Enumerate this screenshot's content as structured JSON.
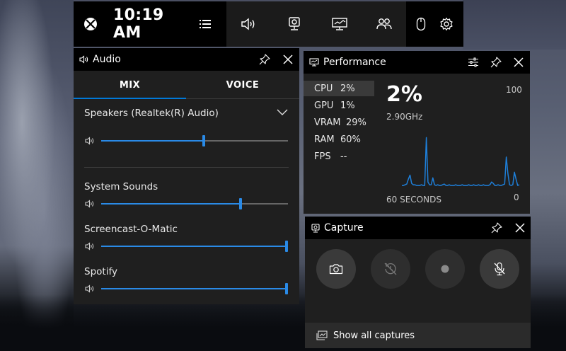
{
  "topbar": {
    "time": "10:19 AM"
  },
  "audio": {
    "title": "Audio",
    "tabs": [
      {
        "label": "MIX",
        "active": true
      },
      {
        "label": "VOICE",
        "active": false
      }
    ],
    "device": {
      "name": "Speakers (Realtek(R) Audio)",
      "volume": 0.55
    },
    "apps": [
      {
        "name": "System Sounds",
        "volume": 0.75
      },
      {
        "name": "Screencast-O-Matic",
        "volume": 1.0
      },
      {
        "name": "Spotify",
        "volume": 1.0
      }
    ]
  },
  "performance": {
    "title": "Performance",
    "metrics": [
      {
        "name": "CPU",
        "value": "2%",
        "selected": true
      },
      {
        "name": "GPU",
        "value": "1%",
        "selected": false
      },
      {
        "name": "VRAM",
        "value": "29%",
        "selected": false
      },
      {
        "name": "RAM",
        "value": "60%",
        "selected": false
      },
      {
        "name": "FPS",
        "value": "--",
        "selected": false
      }
    ],
    "current": "2%",
    "frequency": "2.90GHz",
    "max_label": "100",
    "min_label": "0",
    "time_label": "60 SECONDS",
    "chart_data": {
      "type": "line",
      "ylim": [
        0,
        100
      ],
      "color": "#1e7fd9",
      "values": [
        3,
        3,
        4,
        5,
        12,
        18,
        6,
        4,
        4,
        3,
        3,
        3,
        4,
        3,
        3,
        72,
        8,
        4,
        4,
        14,
        4,
        3,
        4,
        3,
        3,
        4,
        5,
        3,
        3,
        4,
        3,
        3,
        3,
        4,
        3,
        3,
        3,
        4,
        3,
        3,
        3,
        4,
        3,
        3,
        4,
        3,
        3,
        4,
        3,
        3,
        4,
        3,
        3,
        3,
        4,
        8,
        6,
        3,
        3,
        4,
        3,
        3,
        4,
        5,
        44,
        20,
        4,
        3,
        4,
        22,
        12,
        3,
        4
      ]
    }
  },
  "capture": {
    "title": "Capture",
    "footer_label": "Show all captures"
  },
  "colors": {
    "accent": "#0078d7",
    "panel": "#1f1f1f",
    "header": "#000000"
  }
}
